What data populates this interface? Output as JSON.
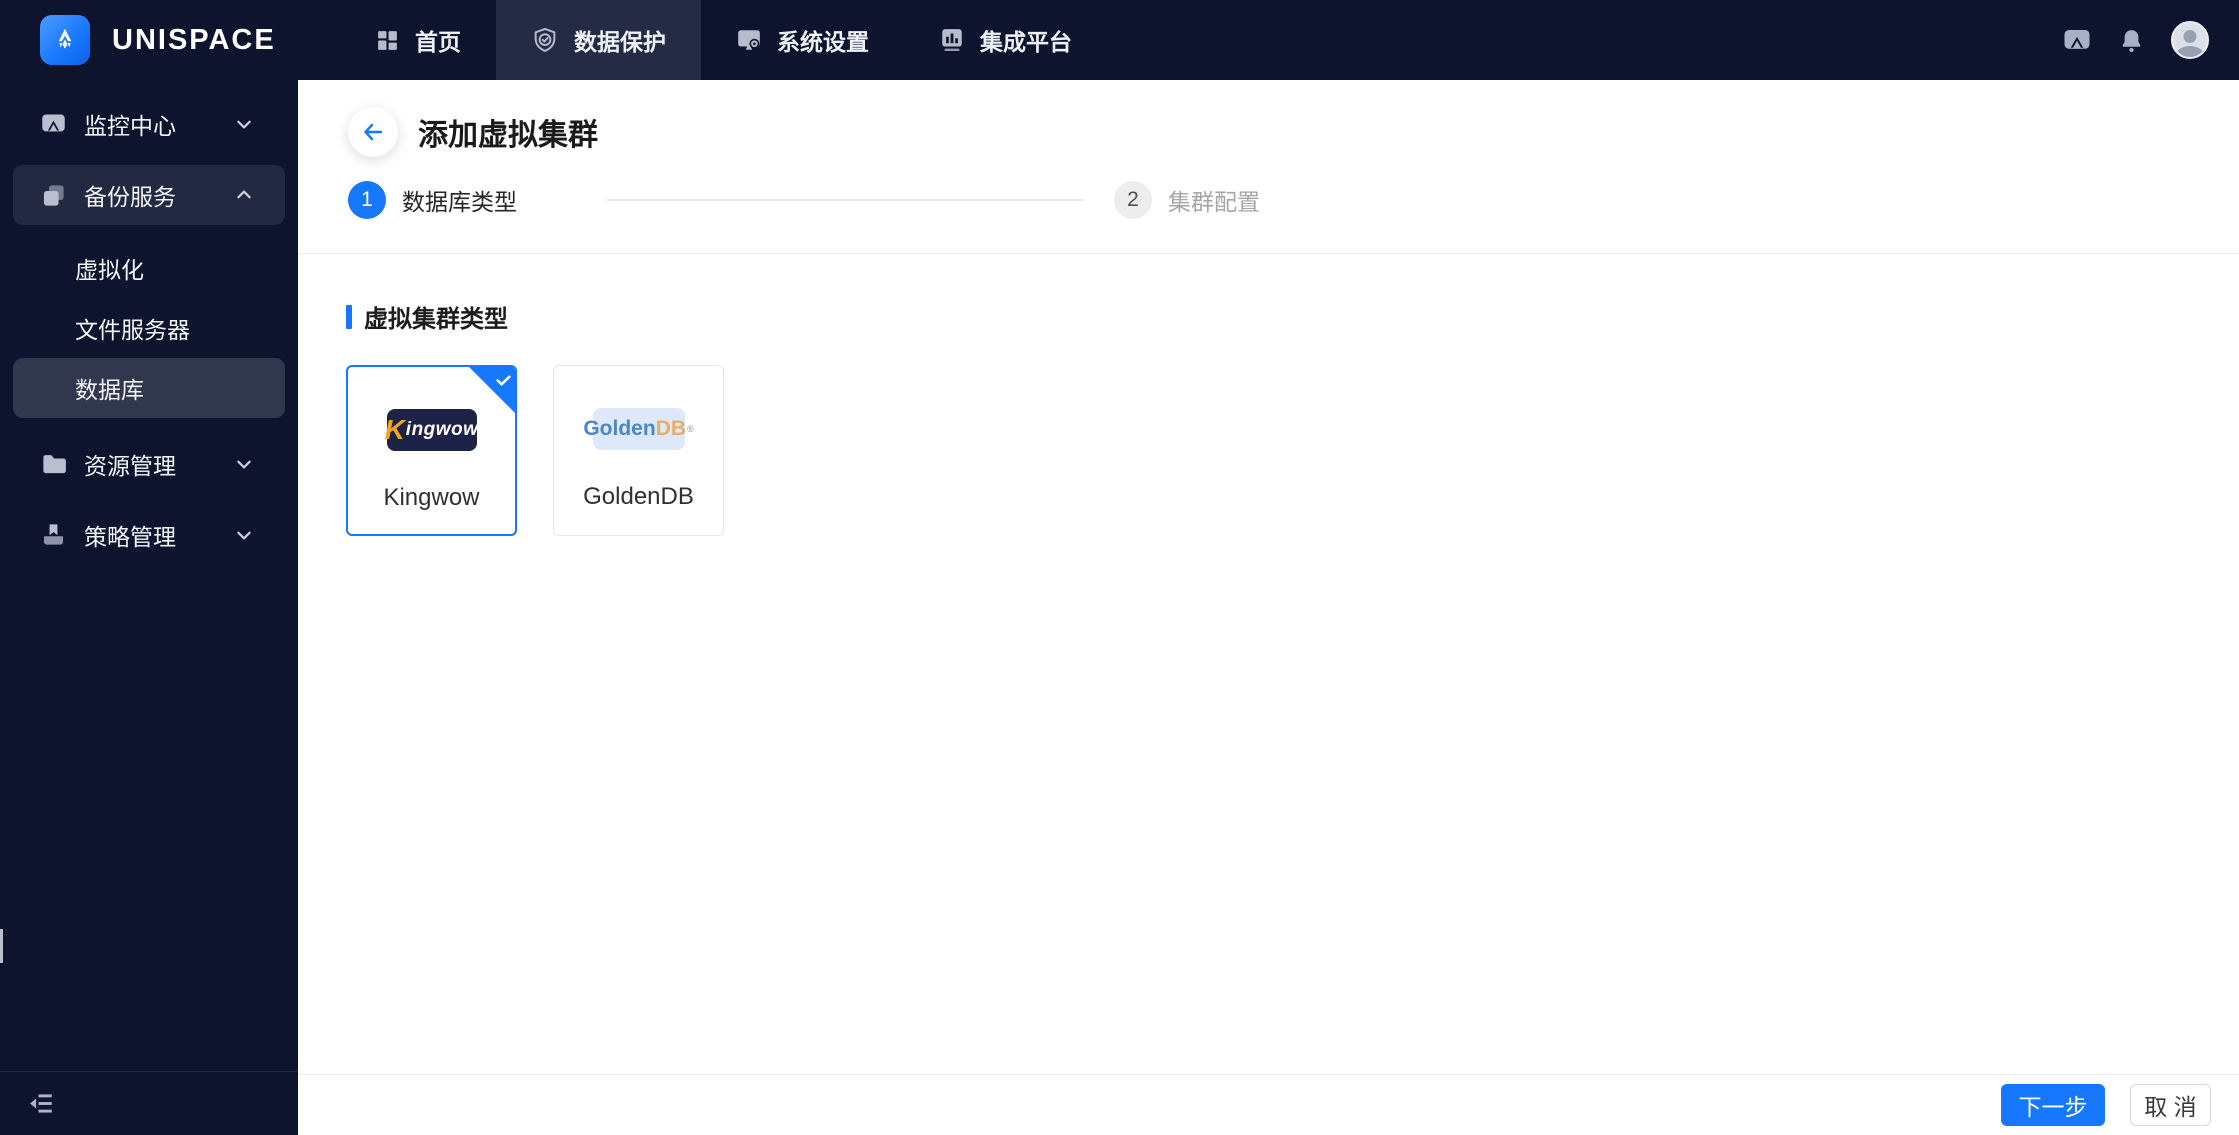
{
  "brand": {
    "name": "UNISPACE"
  },
  "topnav": {
    "tabs": [
      {
        "label": "首页",
        "icon": "dashboard-icon",
        "active": false
      },
      {
        "label": "数据保护",
        "icon": "shield-check-icon",
        "active": true
      },
      {
        "label": "系统设置",
        "icon": "monitor-gear-icon",
        "active": false
      },
      {
        "label": "集成平台",
        "icon": "chart-board-icon",
        "active": false
      }
    ],
    "right_icons": [
      "screen-cast-icon",
      "bell-icon",
      "avatar"
    ]
  },
  "sidebar": {
    "groups": [
      {
        "label": "监控中心",
        "icon": "monitor-cast-icon",
        "chevron": "down",
        "expanded": false
      },
      {
        "label": "备份服务",
        "icon": "copy-icon",
        "chevron": "up",
        "expanded": true
      },
      {
        "label": "资源管理",
        "icon": "folder-icon",
        "chevron": "down",
        "expanded": false
      },
      {
        "label": "策略管理",
        "icon": "policy-book-icon",
        "chevron": "down",
        "expanded": false
      }
    ],
    "backup_children": [
      {
        "label": "虚拟化",
        "active": false
      },
      {
        "label": "文件服务器",
        "active": false
      },
      {
        "label": "数据库",
        "active": true
      }
    ],
    "collapse_icon": "collapse-sidebar-icon"
  },
  "page": {
    "title": "添加虚拟集群",
    "steps": [
      {
        "num": "1",
        "label": "数据库类型",
        "state": "active"
      },
      {
        "num": "2",
        "label": "集群配置",
        "state": "pending"
      }
    ],
    "section_title": "虚拟集群类型",
    "cards": [
      {
        "name": "Kingwow",
        "selected": true,
        "logo": {
          "k": "K",
          "rest": "ingwow"
        }
      },
      {
        "name": "GoldenDB",
        "selected": false,
        "logo": {
          "golden": "Golden",
          "db": "DB",
          "reg": "®"
        }
      }
    ]
  },
  "footer": {
    "next_label": "下一步",
    "cancel_label": "取 消"
  },
  "colors": {
    "accent": "#1677ff",
    "topbar_bg": "#0e142e",
    "active_tab_bg": "#252b44",
    "divider": "#f0f0f0",
    "kingwow_logo_bg": "#1d2347",
    "kingwow_orange": "#f6a41d",
    "goldendb_bg": "#dde9fa",
    "goldendb_blue": "#4c86c6",
    "goldendb_orange": "#e9ad67"
  }
}
